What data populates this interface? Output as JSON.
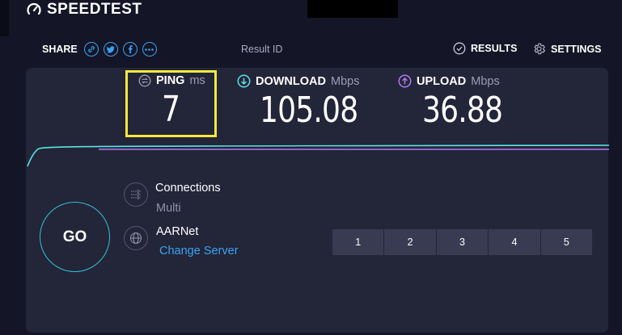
{
  "header": {
    "brand": "SPEEDTEST",
    "brand_icon": "gauge-icon"
  },
  "share": {
    "label": "SHARE",
    "icons": [
      "link-icon",
      "twitter-icon",
      "facebook-icon",
      "more-icon"
    ],
    "result_id_label": "Result ID"
  },
  "nav": {
    "results_label": "RESULTS",
    "settings_label": "SETTINGS"
  },
  "metrics": {
    "ping": {
      "label": "PING",
      "unit": "ms",
      "value": "7"
    },
    "download": {
      "label": "DOWNLOAD",
      "unit": "Mbps",
      "value": "105.08"
    },
    "upload": {
      "label": "UPLOAD",
      "unit": "Mbps",
      "value": "36.88"
    }
  },
  "go_button": {
    "label": "GO"
  },
  "connections": {
    "title": "Connections",
    "mode": "Multi"
  },
  "server": {
    "name": "AARNet",
    "change_label": "Change Server"
  },
  "connection_counts": [
    "1",
    "2",
    "3",
    "4",
    "5"
  ],
  "colors": {
    "background": "#141526",
    "panel": "#232539",
    "accent_blue": "#3aa4f3",
    "download_cyan": "#5ee3e6",
    "upload_purple": "#b07cf0",
    "highlight_yellow": "#f5e93c"
  }
}
